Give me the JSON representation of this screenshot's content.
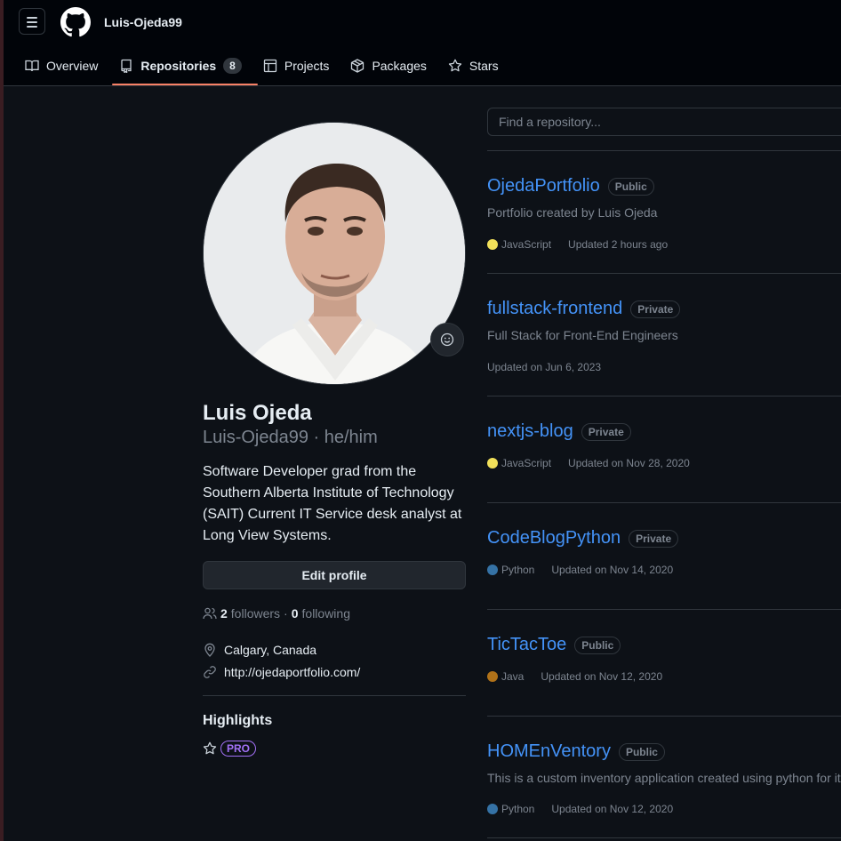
{
  "header": {
    "username": "Luis-Ojeda99",
    "nav": [
      {
        "label": "Overview",
        "icon": "book-icon"
      },
      {
        "label": "Repositories",
        "icon": "repo-icon",
        "count": "8"
      },
      {
        "label": "Projects",
        "icon": "table-icon"
      },
      {
        "label": "Packages",
        "icon": "package-icon"
      },
      {
        "label": "Stars",
        "icon": "star-icon"
      }
    ]
  },
  "profile": {
    "name": "Luis Ojeda",
    "handle": "Luis-Ojeda99 · he/him",
    "bio": "Software Developer grad from the Southern Alberta Institute of Technology (SAIT) Current IT Service desk analyst at Long View Systems.",
    "edit_label": "Edit profile",
    "followers_count": "2",
    "followers_label": "followers",
    "separator": "·",
    "following_count": "0",
    "following_label": "following",
    "location": "Calgary, Canada",
    "website": "http://ojedaportfolio.com/",
    "highlights_title": "Highlights",
    "pro_badge": "PRO"
  },
  "search": {
    "placeholder": "Find a repository..."
  },
  "repos": [
    {
      "name": "OjedaPortfolio",
      "visibility": "Public",
      "description": "Portfolio created by Luis Ojeda",
      "language": "JavaScript",
      "lang_color": "#f1e05a",
      "updated": "Updated 2 hours ago"
    },
    {
      "name": "fullstack-frontend",
      "visibility": "Private",
      "description": "Full Stack for Front-End Engineers",
      "language": "",
      "lang_color": "",
      "updated": "Updated on Jun 6, 2023"
    },
    {
      "name": "nextjs-blog",
      "visibility": "Private",
      "description": "",
      "language": "JavaScript",
      "lang_color": "#f1e05a",
      "updated": "Updated on Nov 28, 2020"
    },
    {
      "name": "CodeBlogPython",
      "visibility": "Private",
      "description": "",
      "language": "Python",
      "lang_color": "#3572a5",
      "updated": "Updated on Nov 14, 2020"
    },
    {
      "name": "TicTacToe",
      "visibility": "Public",
      "description": "",
      "language": "Java",
      "lang_color": "#b07219",
      "updated": "Updated on Nov 12, 2020"
    },
    {
      "name": "HOMEnVentory",
      "visibility": "Public",
      "description": "This is a custom inventory application created using python for it",
      "language": "Python",
      "lang_color": "#3572a5",
      "updated": "Updated on Nov 12, 2020"
    }
  ],
  "colors": {
    "accent": "#4493f8",
    "tab_underline": "#f78166",
    "background": "#0d1117"
  }
}
